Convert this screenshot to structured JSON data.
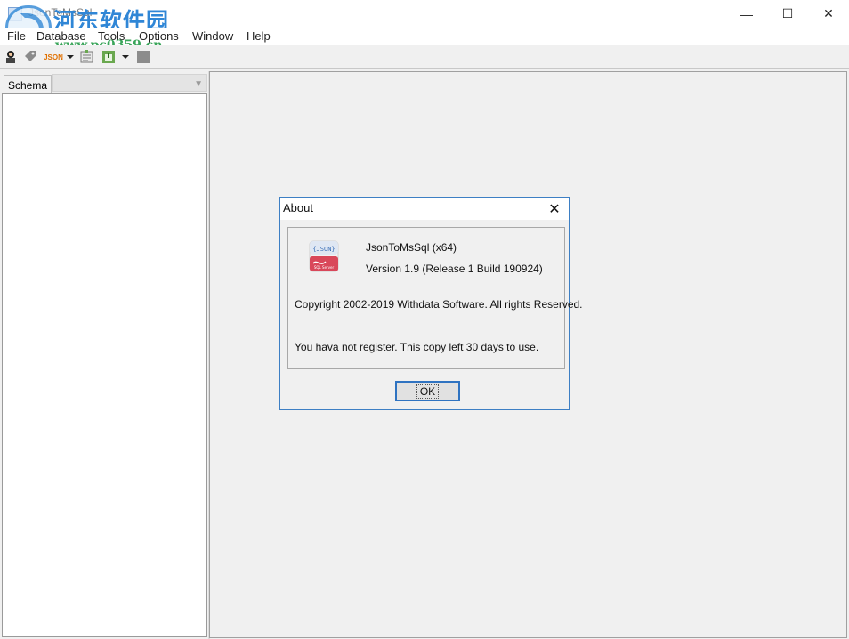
{
  "app": {
    "title": "JsonToMsSql",
    "watermark_text": "河东软件园",
    "watermark_url": "www.pc0359.cn"
  },
  "window_controls": {
    "minimize": "—",
    "maximize": "☐",
    "close": "✕"
  },
  "menu": {
    "items": [
      "File",
      "Database",
      "Tools",
      "Options",
      "Window",
      "Help"
    ]
  },
  "toolbar": {
    "json_label": "JSON"
  },
  "left_panel": {
    "tab_label": "Schema",
    "combo_value": ""
  },
  "about_dialog": {
    "title": "About",
    "close_glyph": "✕",
    "product_name": "JsonToMsSql (x64)",
    "version": "Version 1.9 (Release 1 Build 190924)",
    "copyright": "Copyright 2002-2019 Withdata Software.  All rights Reserved.",
    "register_note": "You hava not register. This copy left 30 days to use.",
    "ok_label": "OK",
    "icon_text_top": "{JSON}",
    "icon_text_bottom": "SQL Server"
  },
  "colors": {
    "dialog_border": "#3d7fc4",
    "ok_focus": "#2f73c1",
    "icon_red": "#d9475a"
  }
}
